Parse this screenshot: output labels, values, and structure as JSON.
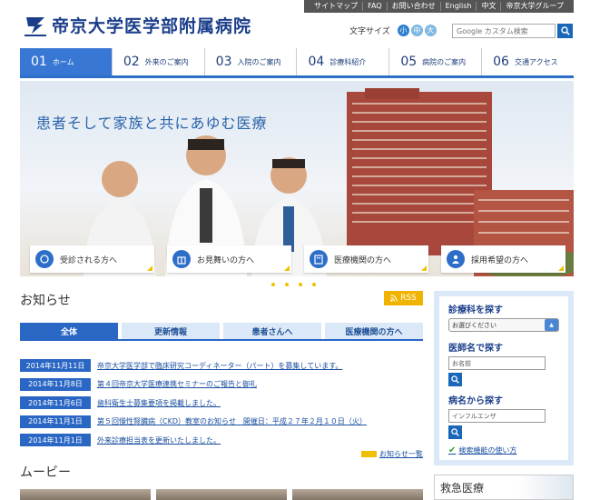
{
  "header": {
    "hospital_name": "帝京大学医学部附属病院",
    "utility_links": [
      "サイトマップ",
      "FAQ",
      "お問い合わせ",
      "English",
      "中文",
      "帝京大学グループ"
    ],
    "font_size_label": "文字サイズ",
    "font_sizes": [
      "小",
      "中",
      "大"
    ],
    "search_placeholder": "Google カスタム検索"
  },
  "nav": [
    {
      "num": "01",
      "label": "ホーム"
    },
    {
      "num": "02",
      "label": "外来のご案内"
    },
    {
      "num": "03",
      "label": "入院のご案内"
    },
    {
      "num": "04",
      "label": "診療科紹介"
    },
    {
      "num": "05",
      "label": "病院のご案内"
    },
    {
      "num": "06",
      "label": "交通アクセス"
    }
  ],
  "hero": {
    "tagline": "患者そして家族と共にあゆむ医療",
    "cards": [
      "受診される方へ",
      "お見舞いの方へ",
      "医療機関の方へ",
      "採用希望の方へ"
    ]
  },
  "news": {
    "title": "お知らせ",
    "rss": "RSS",
    "tabs": [
      "全体",
      "更新情報",
      "患者さんへ",
      "医療機関の方へ"
    ],
    "items": [
      {
        "date": "2014年11月11日",
        "text": "帝京大学医学部で臨床研究コーディネーター（パート）を募集しています。"
      },
      {
        "date": "2014年11月8日",
        "text": "第４回帝京大学医療連携セミナーのご報告と御礼"
      },
      {
        "date": "2014年11月6日",
        "text": "歯科衛生士募集要項を掲載しました。"
      },
      {
        "date": "2014年11月1日",
        "text": "第５回慢性腎臓病（CKD）教室のお知らせ　開催日：平成２７年２月１０日（火）"
      },
      {
        "date": "2014年11月1日",
        "text": "外来診療担当表を更新いたしました。"
      }
    ],
    "more": "お知らせ一覧"
  },
  "movie": {
    "title": "ムービー"
  },
  "sidebar": {
    "dept_heading": "診療科を探す",
    "dept_select": "お選びください",
    "doctor_heading": "医師名で探す",
    "doctor_placeholder": "お名前",
    "disease_heading": "病名から探す",
    "disease_placeholder": "インフルエンザ",
    "help": "検索機能の使い方"
  },
  "emergency": "救急医療"
}
